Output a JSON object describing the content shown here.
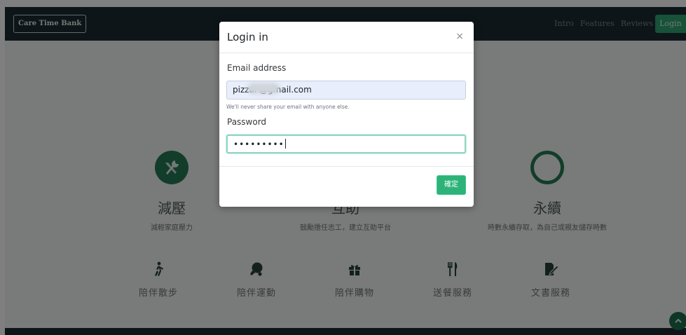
{
  "navbar": {
    "brand": "Care Time Bank",
    "links": [
      "Intro",
      "Features",
      "Reviews"
    ],
    "login_label": "Login"
  },
  "features": [
    {
      "icon": "wrench-icon",
      "title": "減壓",
      "desc": "減輕家庭壓力"
    },
    {
      "icon": "none",
      "title": "互助",
      "desc": "鼓勵擔任志工，建立互助平台"
    },
    {
      "icon": "circle-ring-icon",
      "title": "永續",
      "desc": "時數永續存取，為自己或親友儲存時數"
    }
  ],
  "services": [
    {
      "icon": "walking-icon",
      "label": "陪伴散步"
    },
    {
      "icon": "table-tennis-icon",
      "label": "陪伴運動"
    },
    {
      "icon": "gift-icon",
      "label": "陪伴購物"
    },
    {
      "icon": "utensils-icon",
      "label": "送餐服務"
    },
    {
      "icon": "document-edit-icon",
      "label": "文書服務"
    }
  ],
  "modal": {
    "title": "Login in",
    "close_glyph": "×",
    "email_label": "Email address",
    "email_value": "pizzal        @gmail.com",
    "email_help": "We'll never share your email with anyone else.",
    "password_label": "Password",
    "password_value": "•••••••••",
    "confirm_label": "確定"
  },
  "colors": {
    "brand_green": "#257a55",
    "button_green": "#2db37a",
    "navbar_dark": "#1c2b33"
  }
}
